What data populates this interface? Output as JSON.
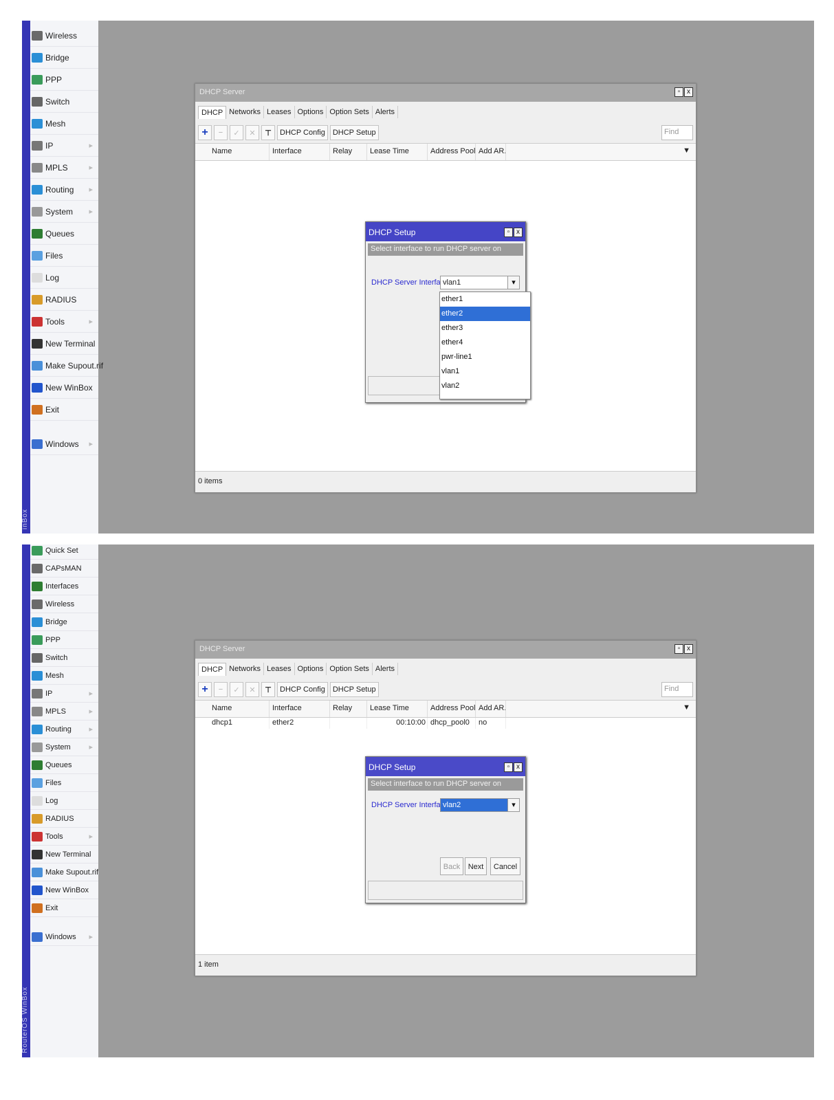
{
  "brand": "RouterOS WinBox",
  "top": {
    "stripe_label": "inBox",
    "menu": [
      {
        "label": "Wireless",
        "icon": "wireless-icon",
        "arrow": false
      },
      {
        "label": "Bridge",
        "icon": "bridge-icon",
        "arrow": false
      },
      {
        "label": "PPP",
        "icon": "ppp-icon",
        "arrow": false
      },
      {
        "label": "Switch",
        "icon": "switch-icon",
        "arrow": false
      },
      {
        "label": "Mesh",
        "icon": "mesh-icon",
        "arrow": false
      },
      {
        "label": "IP",
        "icon": "ip-icon",
        "arrow": true
      },
      {
        "label": "MPLS",
        "icon": "mpls-icon",
        "arrow": true
      },
      {
        "label": "Routing",
        "icon": "routing-icon",
        "arrow": true
      },
      {
        "label": "System",
        "icon": "system-icon",
        "arrow": true
      },
      {
        "label": "Queues",
        "icon": "queues-icon",
        "arrow": false
      },
      {
        "label": "Files",
        "icon": "files-icon",
        "arrow": false
      },
      {
        "label": "Log",
        "icon": "log-icon",
        "arrow": false
      },
      {
        "label": "RADIUS",
        "icon": "radius-icon",
        "arrow": false
      },
      {
        "label": "Tools",
        "icon": "tools-icon",
        "arrow": true
      },
      {
        "label": "New Terminal",
        "icon": "terminal-icon",
        "arrow": false
      },
      {
        "label": "Make Supout.rif",
        "icon": "supout-icon",
        "arrow": false
      },
      {
        "label": "New WinBox",
        "icon": "winbox-icon",
        "arrow": false
      },
      {
        "label": "Exit",
        "icon": "exit-icon",
        "arrow": false
      },
      {
        "label": "Windows",
        "icon": "windows-icon",
        "arrow": true
      }
    ],
    "window": {
      "title": "DHCP Server",
      "tabs": [
        "DHCP",
        "Networks",
        "Leases",
        "Options",
        "Option Sets",
        "Alerts"
      ],
      "toolbar": {
        "config": "DHCP Config",
        "setup": "DHCP Setup",
        "find": "Find"
      },
      "columns": [
        "Name",
        "Interface",
        "Relay",
        "Lease Time",
        "Address Pool",
        "Add AR..."
      ],
      "rows": [],
      "status": "0 items"
    },
    "dialog": {
      "title": "DHCP Setup",
      "subtitle": "Select interface to run DHCP server on",
      "field_label": "DHCP Server Interface:",
      "field_value": "vlan1",
      "options": [
        "ether1",
        "ether2",
        "ether3",
        "ether4",
        "pwr-line1",
        "vlan1",
        "vlan2"
      ],
      "highlighted": "ether2"
    }
  },
  "bottom": {
    "stripe_label": "RouterOS WinBox",
    "menu": [
      {
        "label": "Quick Set",
        "icon": "quickset-icon",
        "arrow": false
      },
      {
        "label": "CAPsMAN",
        "icon": "capsman-icon",
        "arrow": false
      },
      {
        "label": "Interfaces",
        "icon": "interfaces-icon",
        "arrow": false
      },
      {
        "label": "Wireless",
        "icon": "wireless-icon",
        "arrow": false
      },
      {
        "label": "Bridge",
        "icon": "bridge-icon",
        "arrow": false
      },
      {
        "label": "PPP",
        "icon": "ppp-icon",
        "arrow": false
      },
      {
        "label": "Switch",
        "icon": "switch-icon",
        "arrow": false
      },
      {
        "label": "Mesh",
        "icon": "mesh-icon",
        "arrow": false
      },
      {
        "label": "IP",
        "icon": "ip-icon",
        "arrow": true
      },
      {
        "label": "MPLS",
        "icon": "mpls-icon",
        "arrow": true
      },
      {
        "label": "Routing",
        "icon": "routing-icon",
        "arrow": true
      },
      {
        "label": "System",
        "icon": "system-icon",
        "arrow": true
      },
      {
        "label": "Queues",
        "icon": "queues-icon",
        "arrow": false
      },
      {
        "label": "Files",
        "icon": "files-icon",
        "arrow": false
      },
      {
        "label": "Log",
        "icon": "log-icon",
        "arrow": false
      },
      {
        "label": "RADIUS",
        "icon": "radius-icon",
        "arrow": false
      },
      {
        "label": "Tools",
        "icon": "tools-icon",
        "arrow": true
      },
      {
        "label": "New Terminal",
        "icon": "terminal-icon",
        "arrow": false
      },
      {
        "label": "Make Supout.rif",
        "icon": "supout-icon",
        "arrow": false
      },
      {
        "label": "New WinBox",
        "icon": "winbox-icon",
        "arrow": false
      },
      {
        "label": "Exit",
        "icon": "exit-icon",
        "arrow": false
      },
      {
        "label": "Windows",
        "icon": "windows-icon",
        "arrow": true
      }
    ],
    "window": {
      "title": "DHCP Server",
      "tabs": [
        "DHCP",
        "Networks",
        "Leases",
        "Options",
        "Option Sets",
        "Alerts"
      ],
      "toolbar": {
        "config": "DHCP Config",
        "setup": "DHCP Setup",
        "find": "Find"
      },
      "columns": [
        "Name",
        "Interface",
        "Relay",
        "Lease Time",
        "Address Pool",
        "Add AR..."
      ],
      "rows": [
        [
          "dhcp1",
          "ether2",
          "",
          "00:10:00",
          "dhcp_pool0",
          "no"
        ]
      ],
      "status": "1 item"
    },
    "dialog": {
      "title": "DHCP Setup",
      "subtitle": "Select interface to run DHCP server on",
      "field_label": "DHCP Server Interface:",
      "field_value": "vlan2",
      "buttons": {
        "back": "Back",
        "next": "Next",
        "cancel": "Cancel"
      }
    }
  },
  "colors": {
    "panel": "#9c9c9c",
    "stripe": "#3535b5",
    "dialog_title": "#4545c6",
    "highlight": "#2f6fd6",
    "field_label": "#2a2acf"
  }
}
